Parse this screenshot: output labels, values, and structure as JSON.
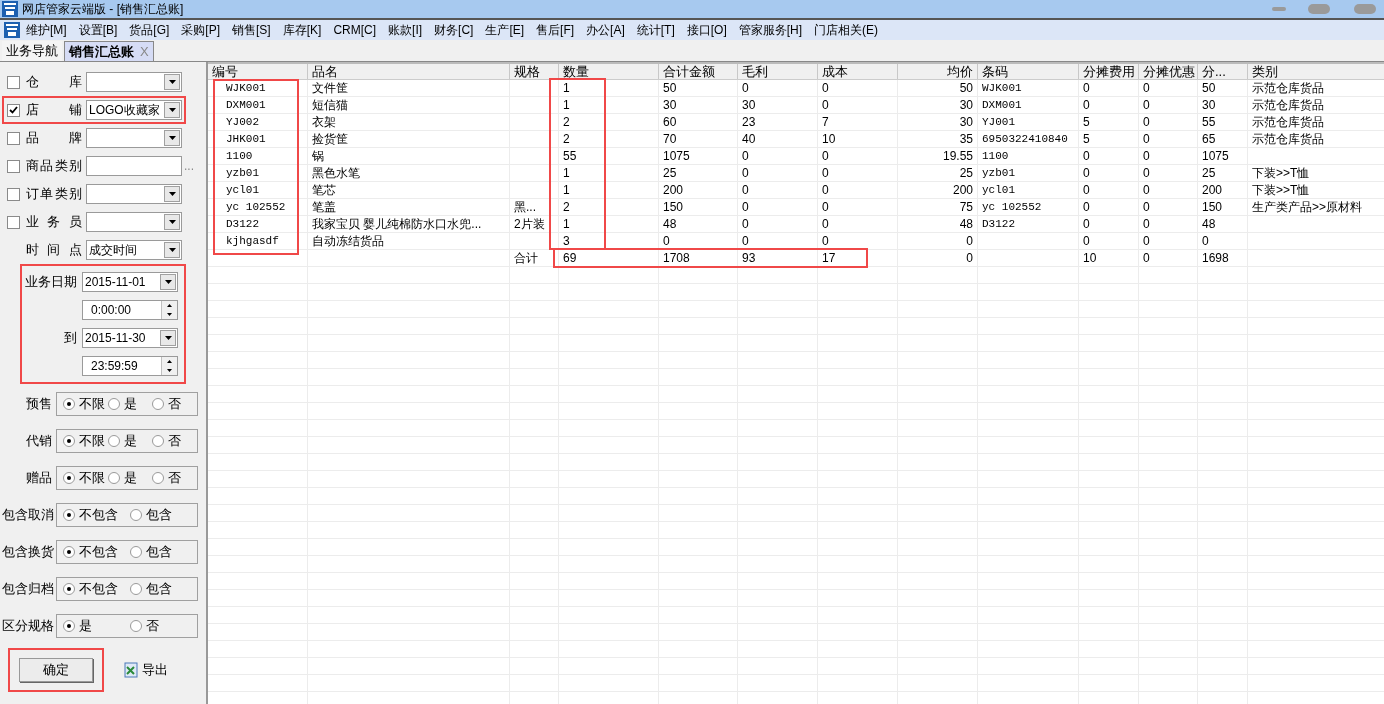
{
  "window": {
    "title": "网店管家云端版 - [销售汇总账]"
  },
  "menu": [
    "维护[M]",
    "设置[B]",
    "货品[G]",
    "采购[P]",
    "销售[S]",
    "库存[K]",
    "CRM[C]",
    "账款[I]",
    "财务[C]",
    "生产[E]",
    "售后[F]",
    "办公[A]",
    "统计[T]",
    "接口[O]",
    "管家服务[H]",
    "门店相关(E)"
  ],
  "tabs": [
    {
      "label": "业务导航",
      "selected": false
    },
    {
      "label": "销售汇总账",
      "selected": true,
      "close": "X"
    }
  ],
  "filters": [
    {
      "kind": "select",
      "label": "仓 库",
      "checked": false
    },
    {
      "kind": "select",
      "label": "店 铺",
      "checked": true,
      "value": "LOGO收藏家",
      "highlighted": true
    },
    {
      "kind": "select",
      "label": "品 牌",
      "checked": false
    },
    {
      "kind": "text",
      "label": "商品类别",
      "checked": false,
      "button": "..."
    },
    {
      "kind": "select",
      "label": "订单类别",
      "checked": false
    },
    {
      "kind": "select",
      "label": "业 务 员",
      "checked": false
    },
    {
      "kind": "select",
      "label": "时 间 点",
      "value": "成交时间"
    }
  ],
  "date_range": {
    "highlighted": true,
    "items": [
      {
        "label": "业务日期",
        "date": "2015-11-01",
        "time": "0:00:00"
      },
      {
        "label": "到",
        "date": "2015-11-30",
        "time": "23:59:59"
      }
    ]
  },
  "radio_groups": [
    {
      "label": "预售",
      "options": [
        {
          "label": "不限",
          "selected": true
        },
        {
          "label": "是",
          "selected": false
        },
        {
          "label": "否",
          "selected": false
        }
      ]
    },
    {
      "label": "代销",
      "options": [
        {
          "label": "不限",
          "selected": true
        },
        {
          "label": "是",
          "selected": false
        },
        {
          "label": "否",
          "selected": false
        }
      ]
    },
    {
      "label": "赠品",
      "options": [
        {
          "label": "不限",
          "selected": true
        },
        {
          "label": "是",
          "selected": false
        },
        {
          "label": "否",
          "selected": false
        }
      ]
    },
    {
      "label": "包含取消",
      "options": [
        {
          "label": "不包含",
          "selected": true
        },
        {
          "label": "包含",
          "selected": false
        }
      ]
    },
    {
      "label": "包含换货",
      "options": [
        {
          "label": "不包含",
          "selected": true
        },
        {
          "label": "包含",
          "selected": false
        }
      ]
    },
    {
      "label": "包含归档",
      "options": [
        {
          "label": "不包含",
          "selected": true
        },
        {
          "label": "包含",
          "selected": false
        }
      ]
    },
    {
      "label": "区分规格",
      "options": [
        {
          "label": "是",
          "selected": true
        },
        {
          "label": "否",
          "selected": false
        }
      ]
    }
  ],
  "confirm_button": {
    "label": "确定",
    "highlighted": true
  },
  "export_button": {
    "label": "导出"
  },
  "table": {
    "columns": [
      "编号",
      "品名",
      "规格",
      "数量",
      "合计金额",
      "毛利",
      "成本",
      "均价",
      "条码",
      "分摊费用",
      "分摊优惠",
      "分...",
      "类别"
    ],
    "rows": [
      [
        "WJK001",
        "文件筐",
        null,
        "1",
        "50",
        "0",
        "0",
        "50",
        "WJK001",
        "0",
        "0",
        "50",
        "示范仓库货品"
      ],
      [
        "DXM001",
        "短信猫",
        null,
        "1",
        "30",
        "30",
        "0",
        "30",
        "DXM001",
        "0",
        "0",
        "30",
        "示范仓库货品"
      ],
      [
        "YJ002",
        "衣架",
        null,
        "2",
        "60",
        "23",
        "7",
        "30",
        "YJ001",
        "5",
        "0",
        "55",
        "示范仓库货品"
      ],
      [
        "JHK001",
        "捡货筐",
        null,
        "2",
        "70",
        "40",
        "10",
        "35",
        "6950322410840",
        "5",
        "0",
        "65",
        "示范仓库货品"
      ],
      [
        "1100",
        "锅",
        null,
        "55",
        "1075",
        "0",
        "0",
        "19.55",
        "1100",
        "0",
        "0",
        "1075",
        null
      ],
      [
        "yzb01",
        "黑色水笔",
        null,
        "1",
        "25",
        "0",
        "0",
        "25",
        "yzb01",
        "0",
        "0",
        "25",
        "下装>>T恤"
      ],
      [
        "ycl01",
        "笔芯",
        null,
        "1",
        "200",
        "0",
        "0",
        "200",
        "ycl01",
        "0",
        "0",
        "200",
        "下装>>T恤"
      ],
      [
        "yc 102552",
        "笔盖",
        "黑...",
        "2",
        "150",
        "0",
        "0",
        "75",
        "yc 102552",
        "0",
        "0",
        "150",
        "生产类产品>>原材料"
      ],
      [
        "D3122",
        "我家宝贝 婴儿纯棉防水口水兜...",
        "2片装",
        "1",
        "48",
        "0",
        "0",
        "48",
        "D3122",
        "0",
        "0",
        "48",
        null
      ],
      [
        "kjhgasdf",
        "自动冻结货品",
        null,
        "3",
        "0",
        "0",
        "0",
        "0",
        null,
        "0",
        "0",
        "0",
        null
      ]
    ],
    "totals": {
      "2": "合计",
      "3": "69",
      "4": "1708",
      "5": "93",
      "6": "17",
      "7": "0",
      "9": "10",
      "10": "0",
      "11": "1698"
    },
    "highlight_boxes": [
      {
        "kind": "code-column"
      },
      {
        "kind": "quantity-column"
      },
      {
        "kind": "totals"
      }
    ]
  }
}
